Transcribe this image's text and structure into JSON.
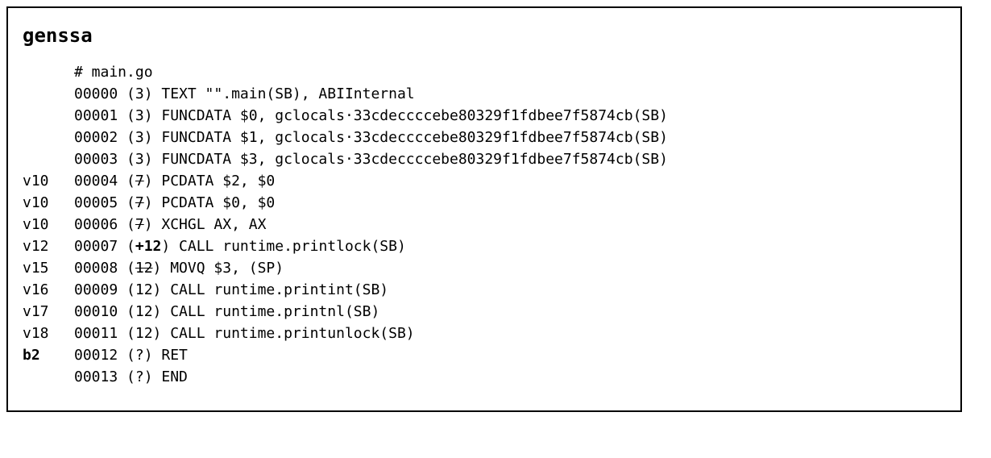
{
  "title": "genssa",
  "rows": [
    {
      "label": "",
      "labelBold": false,
      "segments": [
        {
          "text": "# main.go"
        }
      ]
    },
    {
      "label": "",
      "labelBold": false,
      "segments": [
        {
          "text": "00000 (3) TEXT \"\".main(SB), ABIInternal"
        }
      ]
    },
    {
      "label": "",
      "labelBold": false,
      "segments": [
        {
          "text": "00001 (3) FUNCDATA $0, gclocals·33cdeccccebe80329f1fdbee7f5874cb(SB)"
        }
      ]
    },
    {
      "label": "",
      "labelBold": false,
      "segments": [
        {
          "text": "00002 (3) FUNCDATA $1, gclocals·33cdeccccebe80329f1fdbee7f5874cb(SB)"
        }
      ]
    },
    {
      "label": "",
      "labelBold": false,
      "segments": [
        {
          "text": "00003 (3) FUNCDATA $3, gclocals·33cdeccccebe80329f1fdbee7f5874cb(SB)"
        }
      ]
    },
    {
      "label": "v10",
      "labelBold": false,
      "segments": [
        {
          "text": "00004 ("
        },
        {
          "text": "7",
          "strike": true
        },
        {
          "text": ") PCDATA $2, $0"
        }
      ]
    },
    {
      "label": "v10",
      "labelBold": false,
      "segments": [
        {
          "text": "00005 ("
        },
        {
          "text": "7",
          "strike": true
        },
        {
          "text": ") PCDATA $0, $0"
        }
      ]
    },
    {
      "label": "v10",
      "labelBold": false,
      "segments": [
        {
          "text": "00006 ("
        },
        {
          "text": "7",
          "strike": true
        },
        {
          "text": ") XCHGL AX, AX"
        }
      ]
    },
    {
      "label": "v12",
      "labelBold": false,
      "segments": [
        {
          "text": "00007 ("
        },
        {
          "text": "+12",
          "bold": true
        },
        {
          "text": ") CALL runtime.printlock(SB)"
        }
      ]
    },
    {
      "label": "v15",
      "labelBold": false,
      "segments": [
        {
          "text": "00008 ("
        },
        {
          "text": "12",
          "strike": true
        },
        {
          "text": ") MOVQ $3, (SP)"
        }
      ]
    },
    {
      "label": "v16",
      "labelBold": false,
      "segments": [
        {
          "text": "00009 (12) CALL runtime.printint(SB)"
        }
      ]
    },
    {
      "label": "v17",
      "labelBold": false,
      "segments": [
        {
          "text": "00010 (12) CALL runtime.printnl(SB)"
        }
      ]
    },
    {
      "label": "v18",
      "labelBold": false,
      "segments": [
        {
          "text": "00011 (12) CALL runtime.printunlock(SB)"
        }
      ]
    },
    {
      "label": "b2",
      "labelBold": true,
      "segments": [
        {
          "text": "00012 (?) RET"
        }
      ]
    },
    {
      "label": "",
      "labelBold": false,
      "segments": [
        {
          "text": "00013 (?) END"
        }
      ]
    }
  ]
}
